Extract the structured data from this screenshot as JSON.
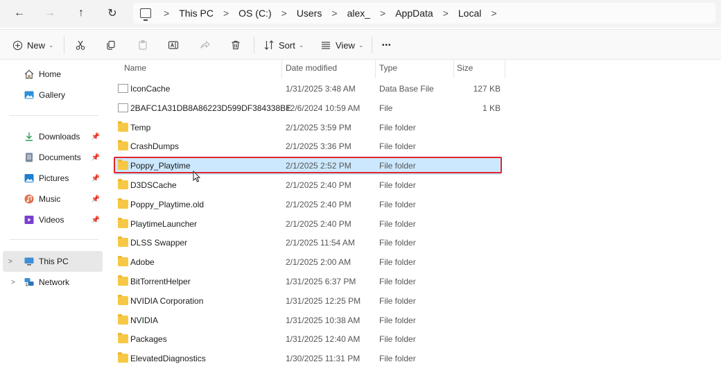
{
  "nav": {
    "back_glyph": "←",
    "forward_glyph": "→",
    "up_glyph": "↑",
    "refresh_glyph": "↻"
  },
  "breadcrumbs": [
    "This PC",
    "OS (C:)",
    "Users",
    "alex_",
    "AppData",
    "Local"
  ],
  "toolbar": {
    "new_label": "New",
    "sort_label": "Sort",
    "view_label": "View",
    "more_glyph": "•••"
  },
  "sidebar": {
    "items": [
      {
        "label": "Home",
        "icon": "home-icon"
      },
      {
        "label": "Gallery",
        "icon": "gallery-icon"
      },
      {
        "label": "Downloads",
        "icon": "downloads-icon",
        "pinned": true
      },
      {
        "label": "Documents",
        "icon": "documents-icon",
        "pinned": true
      },
      {
        "label": "Pictures",
        "icon": "pictures-icon",
        "pinned": true
      },
      {
        "label": "Music",
        "icon": "music-icon",
        "pinned": true
      },
      {
        "label": "Videos",
        "icon": "videos-icon",
        "pinned": true
      },
      {
        "label": "This PC",
        "icon": "this-pc-icon",
        "selected": true
      },
      {
        "label": "Network",
        "icon": "network-icon"
      }
    ]
  },
  "columns": {
    "name": "Name",
    "date": "Date modified",
    "type": "Type",
    "size": "Size"
  },
  "files": [
    {
      "name": "IconCache",
      "date": "1/31/2025 3:48 AM",
      "type": "Data Base File",
      "size": "127 KB",
      "kind": "file"
    },
    {
      "name": "2BAFC1A31DB8A86223D599DF384338BE",
      "date": "12/6/2024 10:59 AM",
      "type": "File",
      "size": "1 KB",
      "kind": "file"
    },
    {
      "name": "Temp",
      "date": "2/1/2025 3:59 PM",
      "type": "File folder",
      "size": "",
      "kind": "folder"
    },
    {
      "name": "CrashDumps",
      "date": "2/1/2025 3:36 PM",
      "type": "File folder",
      "size": "",
      "kind": "folder"
    },
    {
      "name": "Poppy_Playtime",
      "date": "2/1/2025 2:52 PM",
      "type": "File folder",
      "size": "",
      "kind": "folder",
      "selected": true
    },
    {
      "name": "D3DSCache",
      "date": "2/1/2025 2:40 PM",
      "type": "File folder",
      "size": "",
      "kind": "folder"
    },
    {
      "name": "Poppy_Playtime.old",
      "date": "2/1/2025 2:40 PM",
      "type": "File folder",
      "size": "",
      "kind": "folder"
    },
    {
      "name": "PlaytimeLauncher",
      "date": "2/1/2025 2:40 PM",
      "type": "File folder",
      "size": "",
      "kind": "folder"
    },
    {
      "name": "DLSS Swapper",
      "date": "2/1/2025 11:54 AM",
      "type": "File folder",
      "size": "",
      "kind": "folder"
    },
    {
      "name": "Adobe",
      "date": "2/1/2025 2:00 AM",
      "type": "File folder",
      "size": "",
      "kind": "folder"
    },
    {
      "name": "BitTorrentHelper",
      "date": "1/31/2025 6:37 PM",
      "type": "File folder",
      "size": "",
      "kind": "folder"
    },
    {
      "name": "NVIDIA Corporation",
      "date": "1/31/2025 12:25 PM",
      "type": "File folder",
      "size": "",
      "kind": "folder"
    },
    {
      "name": "NVIDIA",
      "date": "1/31/2025 10:38 AM",
      "type": "File folder",
      "size": "",
      "kind": "folder"
    },
    {
      "name": "Packages",
      "date": "1/31/2025 12:40 AM",
      "type": "File folder",
      "size": "",
      "kind": "folder"
    },
    {
      "name": "ElevatedDiagnostics",
      "date": "1/30/2025 11:31 PM",
      "type": "File folder",
      "size": "",
      "kind": "folder"
    }
  ],
  "colors": {
    "selection": "#cce8ff",
    "highlight_box": "#e0262a",
    "folder": "#f6c845"
  }
}
